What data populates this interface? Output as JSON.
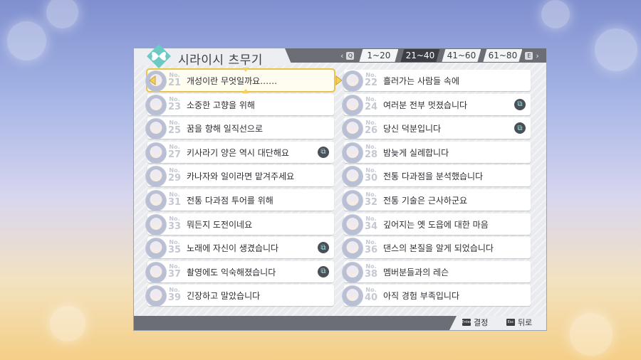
{
  "title": "시라이시 츠무기",
  "title_icon": "butterfly-icon",
  "tab_prev_key": "Q",
  "tab_next_key": "E",
  "tabs": [
    {
      "label": "1~20",
      "active": false
    },
    {
      "label": "21~40",
      "active": true
    },
    {
      "label": "41~60",
      "active": false
    },
    {
      "label": "61~80",
      "active": false
    }
  ],
  "no_prefix": "No.",
  "entries": [
    {
      "no": "21",
      "label": "개성이란 무엇일까요……",
      "selected": true,
      "clip": false
    },
    {
      "no": "22",
      "label": "흘러가는 사람들 속에",
      "selected": false,
      "clip": false
    },
    {
      "no": "23",
      "label": "소중한 고향을 위해",
      "selected": false,
      "clip": false
    },
    {
      "no": "24",
      "label": "여러분 전부 멋졌습니다",
      "selected": false,
      "clip": true
    },
    {
      "no": "25",
      "label": "꿈을 향해 일직선으로",
      "selected": false,
      "clip": false
    },
    {
      "no": "26",
      "label": "당신 덕분입니다",
      "selected": false,
      "clip": true
    },
    {
      "no": "27",
      "label": "키사라기 양은 역시 대단해요",
      "selected": false,
      "clip": true
    },
    {
      "no": "28",
      "label": "밤늦게 실례합니다",
      "selected": false,
      "clip": false
    },
    {
      "no": "29",
      "label": "카나자와 일이라면 맡겨주세요",
      "selected": false,
      "clip": false
    },
    {
      "no": "30",
      "label": "전통 다과점을 분석했습니다",
      "selected": false,
      "clip": false
    },
    {
      "no": "31",
      "label": "전통 다과점 투어를 위해",
      "selected": false,
      "clip": false
    },
    {
      "no": "32",
      "label": "전통 기술은 근사하군요",
      "selected": false,
      "clip": false
    },
    {
      "no": "33",
      "label": "뭐든지 도전이네요",
      "selected": false,
      "clip": false
    },
    {
      "no": "34",
      "label": "깊어지는 옛 도읍에 대한 마음",
      "selected": false,
      "clip": false
    },
    {
      "no": "35",
      "label": "노래에 자신이 생겼습니다",
      "selected": false,
      "clip": true
    },
    {
      "no": "36",
      "label": "댄스의 본질을 알게 되었습니다",
      "selected": false,
      "clip": false
    },
    {
      "no": "37",
      "label": "촬영에도 익숙해졌습니다",
      "selected": false,
      "clip": true
    },
    {
      "no": "38",
      "label": "멤버분들과의 레슨",
      "selected": false,
      "clip": false
    },
    {
      "no": "39",
      "label": "긴장하고 말았습니다",
      "selected": false,
      "clip": false
    },
    {
      "no": "40",
      "label": "아직 경험 부족입니다",
      "selected": false,
      "clip": false
    }
  ],
  "footer": {
    "confirm_key": "Enter",
    "confirm_label": "결정",
    "back_key": "Esc",
    "back_label": "뒤로"
  },
  "colors": {
    "accent": "#3b3e44",
    "selection": "#e9c34b",
    "clip_icon": "#9fe5dc"
  }
}
